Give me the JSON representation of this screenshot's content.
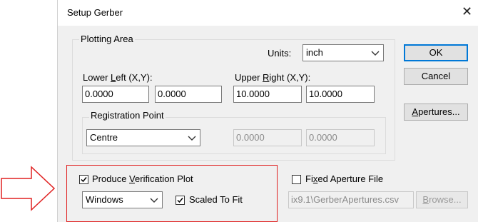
{
  "dialog": {
    "title": "Setup Gerber"
  },
  "plotting_area": {
    "legend": "Plotting Area",
    "units_label": "Units:",
    "units_value": "inch",
    "lower_left_label_pre": "Lower ",
    "lower_left_label_key": "L",
    "lower_left_label_post": "eft (X,Y):",
    "lower_left_x": "0.0000",
    "lower_left_y": "0.0000",
    "upper_right_label_pre": "Upper ",
    "upper_right_label_key": "R",
    "upper_right_label_post": "ight (X,Y):",
    "upper_right_x": "10.0000",
    "upper_right_y": "10.0000"
  },
  "registration": {
    "legend": "Registration Point",
    "value": "Centre",
    "x": "0.0000",
    "y": "0.0000"
  },
  "buttons": {
    "ok": "OK",
    "cancel": "Cancel",
    "apertures_key": "A",
    "apertures_rest": "pertures...",
    "browse_key": "B",
    "browse_rest": "rowse..."
  },
  "verification": {
    "label_pre": "Produce ",
    "label_key": "V",
    "label_post": "erification Plot",
    "checked": true,
    "output_value": "Windows",
    "scaled_label": "Scaled To Fit",
    "scaled_checked": true
  },
  "fixed_aperture": {
    "label_pre": "Fi",
    "label_key": "x",
    "label_post": "ed Aperture File",
    "checked": false,
    "path": "ix9.1\\GerberApertures.csv"
  },
  "colors": {
    "highlight": "#e02020",
    "accent": "#0078d7"
  },
  "icons": [
    "close-icon",
    "chevron-down-icon",
    "checkmark-icon",
    "arrow-right-icon"
  ]
}
